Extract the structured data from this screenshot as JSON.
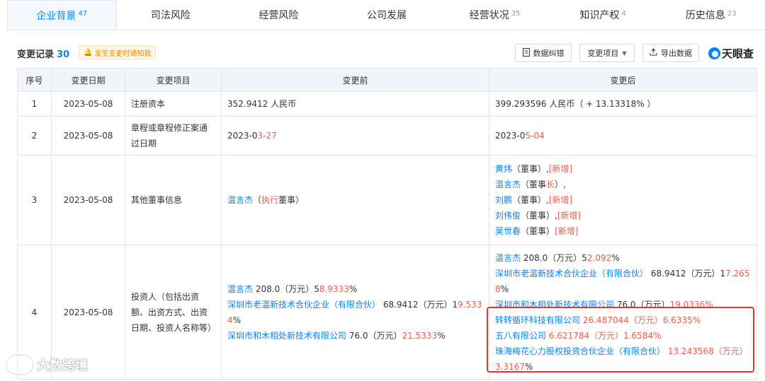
{
  "tabs": [
    {
      "label": "企业背景",
      "count": "47",
      "active": true
    },
    {
      "label": "司法风险",
      "count": ""
    },
    {
      "label": "经营风险",
      "count": ""
    },
    {
      "label": "公司发展",
      "count": ""
    },
    {
      "label": "经营状况",
      "count": "35"
    },
    {
      "label": "知识产权",
      "count": "4"
    },
    {
      "label": "历史信息",
      "count": "23"
    }
  ],
  "toolbar": {
    "title": "变更记录",
    "count": "30",
    "notify_label": "发生变更时通知我",
    "correct_label": "数据纠错",
    "item_label": "变更项目",
    "export_label": "导出数据",
    "logo_text": "天眼查"
  },
  "table": {
    "headers": [
      "序号",
      "变更日期",
      "变更项目",
      "变更前",
      "变更后"
    ],
    "rows": [
      {
        "no": "1",
        "date": "2023-05-08",
        "item": "注册资本",
        "before": "352.9412 人民币",
        "after": "399.293596 人民币（ + 13.13318% ）"
      },
      {
        "no": "2",
        "date": "2023-05-08",
        "item": "章程或章程修正案通过日期",
        "before_a": "2023-0",
        "before_b": "3-27",
        "after_a": "2023-0",
        "after_b": "5-04"
      },
      {
        "no": "3",
        "date": "2023-05-08",
        "item": "其他董事信息",
        "before_name": "温言杰",
        "before_role_a": "（",
        "before_role_b": "执行",
        "before_role_c": "董事）",
        "after": [
          {
            "name": "黄炜",
            "role": "（董事）,",
            "tag": "[新增]"
          },
          {
            "name": "温言杰",
            "role": "（董事",
            "role_red": "长",
            "role_end": "）,",
            "tag": ""
          },
          {
            "name": "刘鹏",
            "role": "（董事）,",
            "tag": "[新增]"
          },
          {
            "name": "刘伟俊",
            "role": "（董事）,",
            "tag": "[新增]"
          },
          {
            "name": "吴世春",
            "role": "（董事）",
            "tag": "[新增]"
          }
        ]
      },
      {
        "no": "4",
        "date": "2023-05-08",
        "item": "投资人（包括出资额、出资方式、出资日期、投资人名称等）",
        "before": [
          {
            "name": "温言杰",
            "amt": "208.0（万元）5",
            "pct": "8.9333",
            "end": "%"
          },
          {
            "name": "深圳市老温新技术合伙企业（有限合伙）",
            "amt": "68.9412（万元）1",
            "pct": "9.533 4",
            "end": "%"
          },
          {
            "name": "深圳市和木相处新技术有限公司",
            "amt": "76.0（万元）",
            "pct": "21.5333",
            "end": "%"
          }
        ],
        "after": [
          {
            "name": "温言杰",
            "amt": "208.0（万元）5",
            "pct": "2.092",
            "end": "%"
          },
          {
            "name": "深圳市老温新技术合伙企业（有限合伙）",
            "amt": "68.9412（万元）1",
            "pct": "7.265 8",
            "end": "%"
          },
          {
            "name": "深圳市和木相处新技术有限公司",
            "amt": "76.0（万元）",
            "pct": "19.0336%",
            "end": ""
          },
          {
            "name": "转转循环科技有限公司",
            "amt": "26.487044（万元）6.6335%",
            "pct": "",
            "end": "",
            "new": true
          },
          {
            "name": "五八有限公司",
            "amt": "6.621784（万元）1.6584%",
            "pct": "",
            "end": "",
            "new": true
          },
          {
            "name": "珠海梅花心力股权投资合伙企业（有限合伙）",
            "amt": "13.243568（万元）3.3167",
            "pct": "",
            "end": "%",
            "new": true
          }
        ]
      }
    ]
  },
  "watermark": "大数跨境",
  "colors": {
    "accent": "#0084ff",
    "change": "#ee5a4c",
    "highlight_box": "#e3372c"
  }
}
